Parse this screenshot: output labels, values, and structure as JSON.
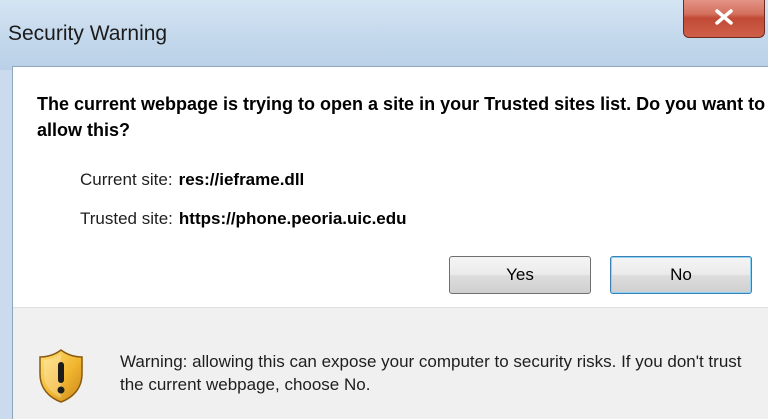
{
  "dialog": {
    "title": "Security Warning",
    "close_icon": "close-x-icon",
    "heading": "The current webpage is trying to open a site in your Trusted sites list. Do you want to allow this?",
    "current_site_label": "Current site:",
    "current_site_value": "res://ieframe.dll",
    "trusted_site_label": "Trusted site:",
    "trusted_site_value": "https://phone.peoria.uic.edu",
    "yes_label": "Yes",
    "no_label": "No",
    "warning_icon": "warning-shield-icon",
    "warning_text": "Warning: allowing this can expose your computer to security risks. If you don't trust the current webpage, choose No."
  },
  "colors": {
    "title_bar": "#c4d8ec",
    "close_button": "#c14a35",
    "shield": "#f2b630",
    "default_button_border": "#3c7fb1",
    "footer_bg": "#f0f0f0"
  }
}
